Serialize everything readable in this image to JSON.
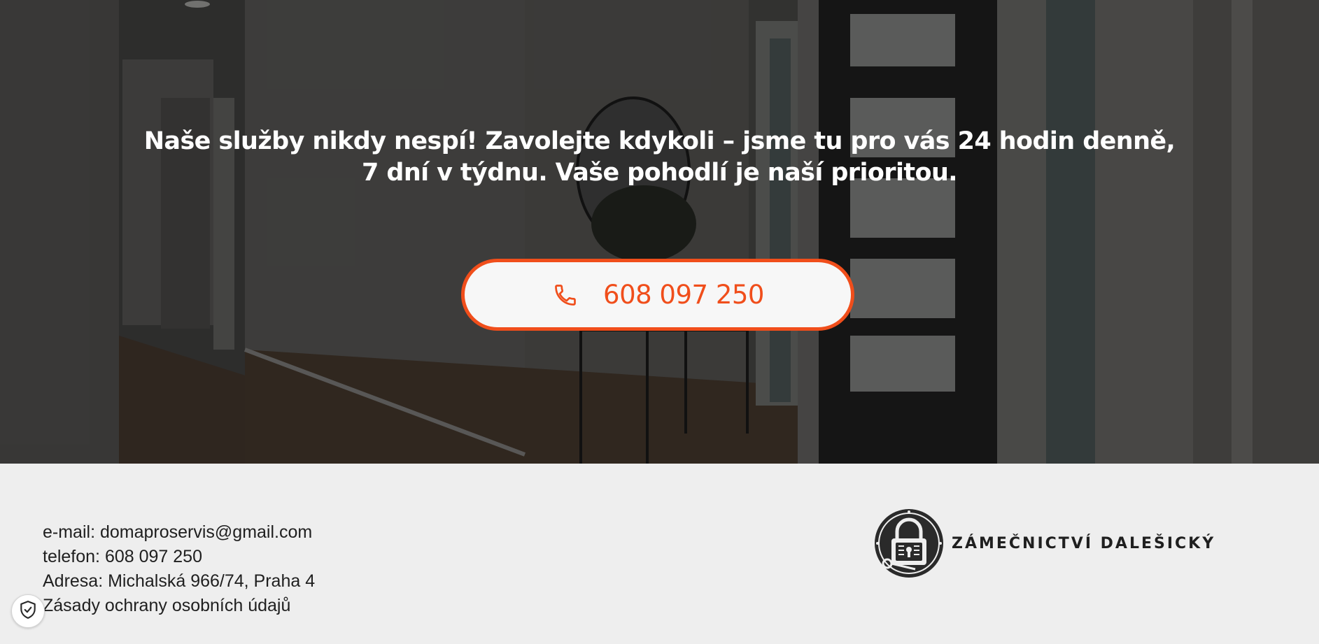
{
  "hero": {
    "message": "Naše služby nikdy nespí! Zavolejte kdykoli – jsme tu pro vás 24 hodin denně, 7 dní v týdnu. Vaše pohodlí je naší prioritou.",
    "call_button": {
      "phone": "608 097 250",
      "icon": "phone-icon"
    }
  },
  "footer": {
    "contact": {
      "email": "e-mail: domaproservis@gmail.com",
      "phone": "telefon: 608 097 250",
      "address": "Adresa: Michalská 966/74, Praha 4",
      "privacy": "Zásady ochrany osobních údajů"
    },
    "brand": {
      "name": "ZÁMEČNICTVÍ DALEŠICKÝ",
      "logo_icon": "padlock-key-logo"
    },
    "cookie_badge_icon": "shield-check-icon"
  },
  "colors": {
    "accent": "#f04e1b",
    "footer_bg": "#eeeeee",
    "hero_text": "#ffffff",
    "dark": "#1f1f1f"
  }
}
